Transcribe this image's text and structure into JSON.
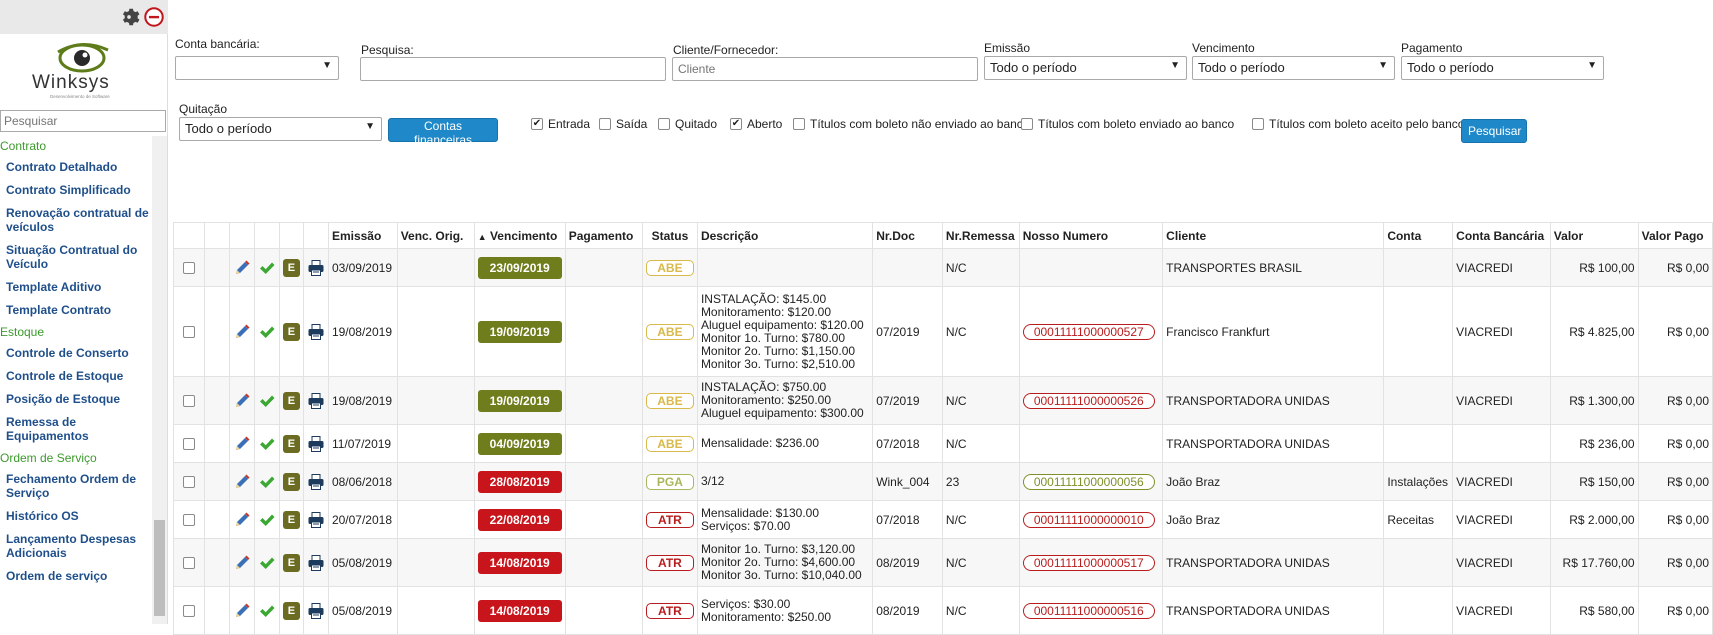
{
  "sidebar": {
    "search_placeholder": "Pesquisar",
    "logo_text": "Winksys",
    "logo_subtitle": "Desenvolvimento de Software",
    "menu": [
      {
        "type": "section",
        "label": "Contrato"
      },
      {
        "type": "item",
        "label": "Contrato Detalhado"
      },
      {
        "type": "item",
        "label": "Contrato Simplificado"
      },
      {
        "type": "item",
        "label": "Renovação contratual de veículos"
      },
      {
        "type": "item",
        "label": "Situação Contratual do Veículo"
      },
      {
        "type": "item",
        "label": "Template Aditivo"
      },
      {
        "type": "item",
        "label": "Template Contrato"
      },
      {
        "type": "section",
        "label": "Estoque"
      },
      {
        "type": "item",
        "label": "Controle de Conserto"
      },
      {
        "type": "item",
        "label": "Controle de Estoque"
      },
      {
        "type": "item",
        "label": "Posição de Estoque"
      },
      {
        "type": "item",
        "label": "Remessa de Equipamentos"
      },
      {
        "type": "section",
        "label": "Ordem de Serviço"
      },
      {
        "type": "item",
        "label": "Fechamento Ordem de Serviço"
      },
      {
        "type": "item",
        "label": "Histórico OS"
      },
      {
        "type": "item",
        "label": "Lançamento Despesas Adicionais"
      },
      {
        "type": "item",
        "label": "Ordem de serviço"
      }
    ]
  },
  "filters": {
    "conta_bancaria_label": "Conta bancária:",
    "conta_bancaria_value": "",
    "pesquisa_label": "Pesquisa:",
    "pesquisa_value": "",
    "cliente_label": "Cliente/Fornecedor:",
    "cliente_placeholder": "Cliente",
    "emissao_label": "Emissão",
    "emissao_value": "Todo o período",
    "vencimento_label": "Vencimento",
    "vencimento_value": "Todo o período",
    "pagamento_label": "Pagamento",
    "pagamento_value": "Todo o período",
    "quitacao_label": "Quitação",
    "quitacao_value": "Todo o período",
    "contas_button": "Contas financeiras",
    "pesquisar_button": "Pesquisar",
    "checkboxes": [
      {
        "label": "Entrada",
        "checked": true
      },
      {
        "label": "Saída",
        "checked": false
      },
      {
        "label": "Quitado",
        "checked": false
      },
      {
        "label": "Aberto",
        "checked": true
      },
      {
        "label": "Títulos com boleto não enviado ao banco",
        "checked": false
      },
      {
        "label": "Títulos com boleto enviado ao banco",
        "checked": false
      },
      {
        "label": "Títulos com boleto aceito pelo banco",
        "checked": false
      }
    ]
  },
  "colors": {
    "venc_green": "#6f7d1c",
    "venc_red": "#c8151b",
    "status_abe": "#d8b94a",
    "status_pga": "#a9b65a",
    "status_atr": "#b91c1c",
    "nn_red": "#b91c1c",
    "nn_green": "#7f8f2a",
    "button_blue": "#1e88c8"
  },
  "table": {
    "sort_indicator": "▲",
    "columns": [
      "Emissão",
      "Venc. Orig.",
      "Vencimento",
      "Pagamento",
      "Status",
      "Descrição",
      "Nr.Doc",
      "Nr.Remessa",
      "Nosso Numero",
      "Cliente",
      "Conta",
      "Conta Bancária",
      "Valor",
      "Valor Pago"
    ],
    "rows": [
      {
        "emissao": "03/09/2019",
        "venc_orig": "",
        "vencimento": "23/09/2019",
        "venc_color": "green",
        "pagamento": "",
        "status": "ABE",
        "descricao": [],
        "nr_doc": "",
        "nr_remessa": "N/C",
        "nosso_numero": "",
        "nn_color": "",
        "cliente": "TRANSPORTES BRASIL",
        "conta": "",
        "conta_bancaria": "VIACREDI",
        "valor": "R$ 100,00",
        "valor_pago": "R$ 0,00"
      },
      {
        "emissao": "19/08/2019",
        "venc_orig": "",
        "vencimento": "19/09/2019",
        "venc_color": "green",
        "pagamento": "",
        "status": "ABE",
        "descricao": [
          "INSTALAÇÃO: $145.00",
          "Monitoramento: $120.00",
          "Aluguel equipamento: $120.00",
          "Monitor 1o. Turno: $780.00",
          "Monitor 2o. Turno: $1,150.00",
          "Monitor 3o. Turno: $2,510.00"
        ],
        "nr_doc": "07/2019",
        "nr_remessa": "N/C",
        "nosso_numero": "00011111000000527",
        "nn_color": "red",
        "cliente": "Francisco Frankfurt",
        "conta": "",
        "conta_bancaria": "VIACREDI",
        "valor": "R$ 4.825,00",
        "valor_pago": "R$ 0,00"
      },
      {
        "emissao": "19/08/2019",
        "venc_orig": "",
        "vencimento": "19/09/2019",
        "venc_color": "green",
        "pagamento": "",
        "status": "ABE",
        "descricao": [
          "INSTALAÇÃO: $750.00",
          "Monitoramento: $250.00",
          "Aluguel equipamento: $300.00"
        ],
        "nr_doc": "07/2019",
        "nr_remessa": "N/C",
        "nosso_numero": "00011111000000526",
        "nn_color": "red",
        "cliente": "TRANSPORTADORA UNIDAS",
        "conta": "",
        "conta_bancaria": "VIACREDI",
        "valor": "R$ 1.300,00",
        "valor_pago": "R$ 0,00"
      },
      {
        "emissao": "11/07/2019",
        "venc_orig": "",
        "vencimento": "04/09/2019",
        "venc_color": "green",
        "pagamento": "",
        "status": "ABE",
        "descricao": [
          "Mensalidade: $236.00"
        ],
        "nr_doc": "07/2018",
        "nr_remessa": "N/C",
        "nosso_numero": "",
        "nn_color": "",
        "cliente": "TRANSPORTADORA UNIDAS",
        "conta": "",
        "conta_bancaria": "",
        "valor": "R$ 236,00",
        "valor_pago": "R$ 0,00"
      },
      {
        "emissao": "08/06/2018",
        "venc_orig": "",
        "vencimento": "28/08/2019",
        "venc_color": "red",
        "pagamento": "",
        "status": "PGA",
        "descricao": [
          "3/12"
        ],
        "nr_doc": "Wink_004",
        "nr_remessa": "23",
        "nosso_numero": "00011111000000056",
        "nn_color": "green",
        "cliente": "João Braz",
        "conta": "Instalações",
        "conta_bancaria": "VIACREDI",
        "valor": "R$ 150,00",
        "valor_pago": "R$ 0,00"
      },
      {
        "emissao": "20/07/2018",
        "venc_orig": "",
        "vencimento": "22/08/2019",
        "venc_color": "red",
        "pagamento": "",
        "status": "ATR",
        "descricao": [
          "Mensalidade: $130.00",
          "Serviços: $70.00"
        ],
        "nr_doc": "07/2018",
        "nr_remessa": "N/C",
        "nosso_numero": "00011111000000010",
        "nn_color": "red",
        "cliente": "João Braz",
        "conta": "Receitas",
        "conta_bancaria": "VIACREDI",
        "valor": "R$ 2.000,00",
        "valor_pago": "R$ 0,00"
      },
      {
        "emissao": "05/08/2019",
        "venc_orig": "",
        "vencimento": "14/08/2019",
        "venc_color": "red",
        "pagamento": "",
        "status": "ATR",
        "descricao": [
          "Monitor 1o. Turno: $3,120.00",
          "Monitor 2o. Turno: $4,600.00",
          "Monitor 3o. Turno: $10,040.00"
        ],
        "nr_doc": "08/2019",
        "nr_remessa": "N/C",
        "nosso_numero": "00011111000000517",
        "nn_color": "red",
        "cliente": "TRANSPORTADORA UNIDAS",
        "conta": "",
        "conta_bancaria": "VIACREDI",
        "valor": "R$ 17.760,00",
        "valor_pago": "R$ 0,00"
      },
      {
        "emissao": "05/08/2019",
        "venc_orig": "",
        "vencimento": "14/08/2019",
        "venc_color": "red",
        "pagamento": "",
        "status": "ATR",
        "descricao": [
          "Serviços: $30.00",
          "Monitoramento: $250.00"
        ],
        "nr_doc": "08/2019",
        "nr_remessa": "N/C",
        "nosso_numero": "00011111000000516",
        "nn_color": "red",
        "cliente": "TRANSPORTADORA UNIDAS",
        "conta": "",
        "conta_bancaria": "VIACREDI",
        "valor": "R$ 580,00",
        "valor_pago": "R$ 0,00"
      }
    ]
  }
}
